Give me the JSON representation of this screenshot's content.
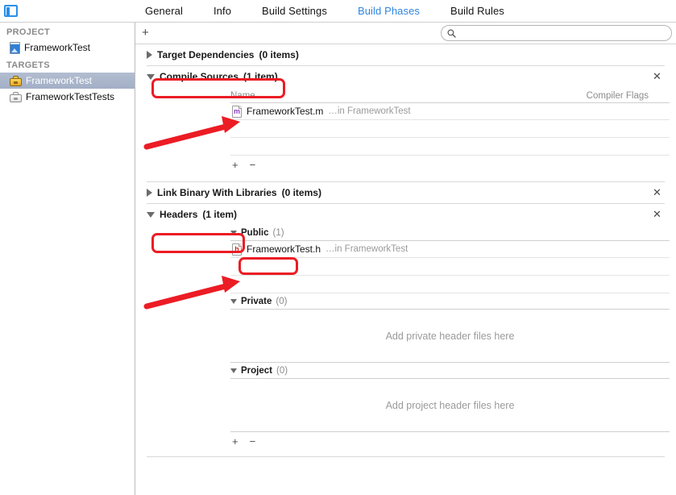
{
  "window": {
    "panel_toggle_icon": "left-panel-toggle-icon"
  },
  "tabs": [
    {
      "label": "General",
      "active": false
    },
    {
      "label": "Info",
      "active": false
    },
    {
      "label": "Build Settings",
      "active": false
    },
    {
      "label": "Build Phases",
      "active": true
    },
    {
      "label": "Build Rules",
      "active": false
    }
  ],
  "sidebar": {
    "project_header": "PROJECT",
    "project_items": [
      {
        "label": "FrameworkTest",
        "icon": "project-document-icon"
      }
    ],
    "targets_header": "TARGETS",
    "target_items": [
      {
        "label": "FrameworkTest",
        "icon": "target-toolbox-icon",
        "selected": true
      },
      {
        "label": "FrameworkTestTests",
        "icon": "target-toolbox-icon",
        "selected": false
      }
    ]
  },
  "toolbar": {
    "add_label": "+",
    "search_placeholder": "",
    "search_value": "",
    "search_icon": "search-icon"
  },
  "phases": {
    "target_dependencies": {
      "title": "Target Dependencies",
      "count": "(0 items)",
      "expanded": false
    },
    "compile_sources": {
      "title": "Compile Sources",
      "count": "(1 item)",
      "expanded": true,
      "close_label": "✕",
      "columns": {
        "name": "Name",
        "flags": "Compiler Flags"
      },
      "files": [
        {
          "name": "FrameworkTest.m",
          "where": "…in FrameworkTest",
          "icon": "objc-source-file-icon",
          "badge": "m"
        }
      ],
      "add_label": "+",
      "remove_label": "−"
    },
    "link_binary": {
      "title": "Link Binary With Libraries",
      "count": "(0 items)",
      "expanded": false,
      "close_label": "✕"
    },
    "headers": {
      "title": "Headers",
      "count": "(1 item)",
      "expanded": true,
      "close_label": "✕",
      "groups": [
        {
          "name": "Public",
          "count": "(1)",
          "files": [
            {
              "name": "FrameworkTest.h",
              "where": "…in FrameworkTest",
              "icon": "header-file-icon",
              "badge": "h"
            }
          ],
          "empty_text": ""
        },
        {
          "name": "Private",
          "count": "(0)",
          "files": [],
          "empty_text": "Add private header files here"
        },
        {
          "name": "Project",
          "count": "(0)",
          "files": [],
          "empty_text": "Add project header files here"
        }
      ],
      "add_label": "+",
      "remove_label": "−"
    }
  },
  "annotations": {
    "color": "#ec1c24",
    "boxes": [
      {
        "name": "compile-sources-highlight"
      },
      {
        "name": "headers-highlight"
      },
      {
        "name": "public-group-highlight"
      }
    ],
    "arrows": [
      {
        "name": "arrow-to-compile-source-file"
      },
      {
        "name": "arrow-to-public-header-file"
      }
    ]
  },
  "colors": {
    "accent_blue": "#2f86e0",
    "annotation_red": "#ec1c24",
    "selection_blue_gray": "#a9b5ca",
    "objc_m_purple": "#8a3fc0",
    "header_h_red": "#c42a22"
  }
}
